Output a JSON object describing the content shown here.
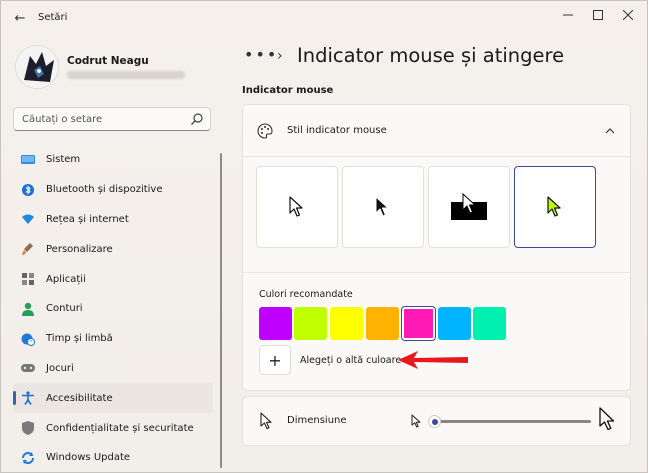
{
  "window": {
    "title": "Setări",
    "back_glyph": "←",
    "controls": {
      "minimize": "—",
      "maximize": "☐",
      "close": "✕"
    }
  },
  "user": {
    "name": "Codrut Neagu"
  },
  "search": {
    "placeholder": "Căutați o setare",
    "icon": "search-icon"
  },
  "sidebar": {
    "items": [
      {
        "label": "Sistem",
        "icon": "monitor-icon",
        "color": "#0078d4"
      },
      {
        "label": "Bluetooth și dispozitive",
        "icon": "bluetooth-icon",
        "color": "#1b6fd6"
      },
      {
        "label": "Rețea și internet",
        "icon": "wifi-icon",
        "color": "#1b8ae0"
      },
      {
        "label": "Personalizare",
        "icon": "paintbrush-icon",
        "color": "#d77b3a"
      },
      {
        "label": "Aplicații",
        "icon": "apps-icon",
        "color": "#555555"
      },
      {
        "label": "Conturi",
        "icon": "person-icon",
        "color": "#2b9d5a"
      },
      {
        "label": "Timp și limbă",
        "icon": "globe-clock-icon",
        "color": "#1f7ad6"
      },
      {
        "label": "Jocuri",
        "icon": "gamepad-icon",
        "color": "#666666"
      },
      {
        "label": "Accesibilitate",
        "icon": "accessibility-icon",
        "color": "#1f6fd0",
        "active": true
      },
      {
        "label": "Confidențialitate și securitate",
        "icon": "shield-icon",
        "color": "#777777"
      },
      {
        "label": "Windows Update",
        "icon": "update-icon",
        "color": "#1f7ad6"
      }
    ]
  },
  "main": {
    "breadcrumb_more": "•••",
    "breadcrumb_separator": "›",
    "title": "Indicator mouse și atingere",
    "section_heading": "Indicator mouse",
    "style_card": {
      "label": "Stil indicator mouse",
      "options": [
        {
          "name": "white-pointer",
          "selected": false
        },
        {
          "name": "black-pointer",
          "selected": false
        },
        {
          "name": "inverted-pointer",
          "selected": false
        },
        {
          "name": "custom-pointer",
          "selected": true,
          "color": "#bfff00"
        }
      ],
      "colors_label": "Culori recomandate",
      "swatches": [
        {
          "color": "#c000ff",
          "selected": false
        },
        {
          "color": "#bfff00",
          "selected": false
        },
        {
          "color": "#ffff00",
          "selected": false
        },
        {
          "color": "#ffb300",
          "selected": false
        },
        {
          "color": "#ff1ab5",
          "selected": true
        },
        {
          "color": "#00b4ff",
          "selected": false
        },
        {
          "color": "#00f0b0",
          "selected": false
        }
      ],
      "add_color_glyph": "+",
      "add_color_label": "Alegeți o altă culoare"
    },
    "size_card": {
      "label": "Dimensiune",
      "slider_value": 1
    }
  },
  "colors": {
    "accent": "#3c4a9e",
    "annotation_arrow": "#e8191e"
  }
}
